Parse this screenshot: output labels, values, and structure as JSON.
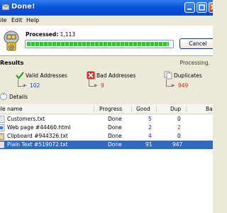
{
  "window": {
    "title": "Done!"
  },
  "menu": [
    "ile",
    "Edit",
    "Help"
  ],
  "progress": {
    "label": "Processed:",
    "count": "1,113",
    "fraction": 0.98,
    "cancel_label": "Cancel"
  },
  "results": {
    "title": "Results",
    "status": "Processing.",
    "groups": [
      {
        "label": "Valid Addresses",
        "value": "102",
        "icon": "checkmark-icon",
        "value_color": "#1a3fb5"
      },
      {
        "label": "Bad Addresses",
        "value": "9",
        "icon": "red-x-icon",
        "value_color": "#d02020"
      },
      {
        "label": "Duplicates",
        "value": "949",
        "icon": "duplicate-pages-icon",
        "value_color": "#d02020"
      }
    ]
  },
  "details_label": "Details",
  "table": {
    "columns": [
      "ile name",
      "Progress",
      "Good",
      "Dup",
      "Ba"
    ],
    "rows": [
      {
        "name": "Customers.txt",
        "progress": "Done",
        "good": "5",
        "dup": "0",
        "icon": "text-file-icon"
      },
      {
        "name": "Web page #44460.html",
        "progress": "Done",
        "good": "2",
        "dup": "2",
        "icon": "html-file-icon"
      },
      {
        "name": "Clipboard #944326.txt",
        "progress": "Done",
        "good": "4",
        "dup": "0",
        "icon": "clipboard-icon"
      },
      {
        "name": "Plain Text #519072.txt",
        "progress": "Done",
        "good": "91",
        "dup": "947",
        "icon": "text-file-icon",
        "selected": true
      }
    ]
  }
}
